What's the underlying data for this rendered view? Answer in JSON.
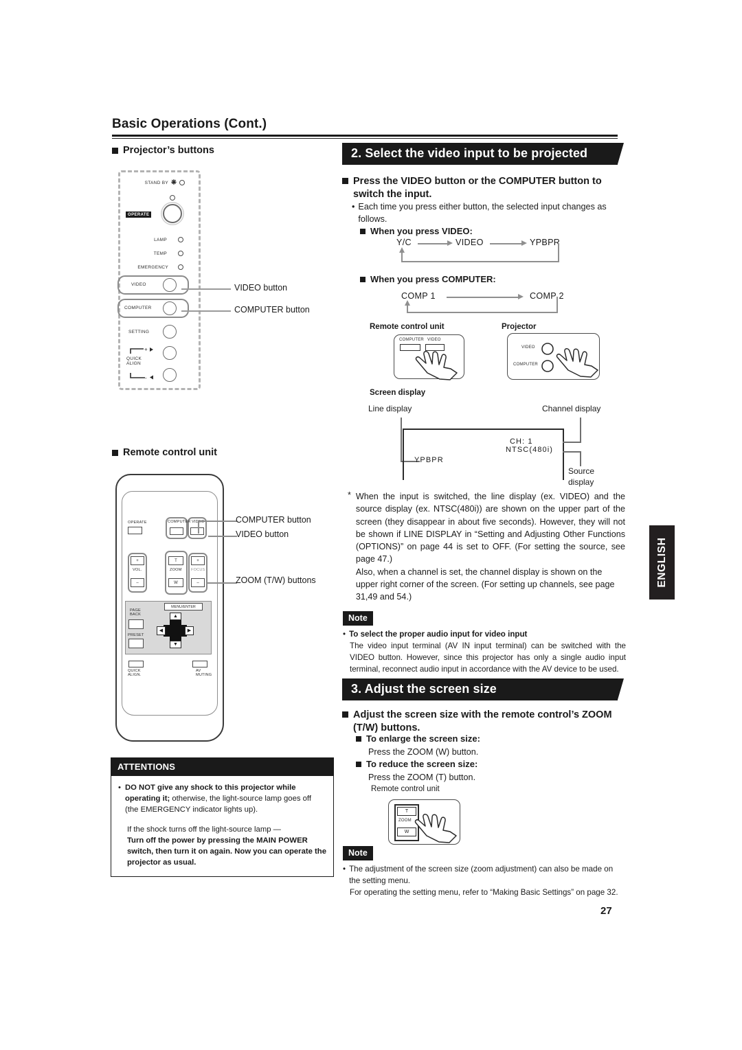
{
  "header": {
    "title": "Basic Operations (Cont.)",
    "page_number": "27",
    "language_tab": "ENGLISH"
  },
  "left": {
    "projector_buttons_heading": "Projector’s buttons",
    "remote_unit_heading": "Remote control unit",
    "projector_panel": {
      "indicators": [
        {
          "label": "STAND BY",
          "glyph": "power-glyph"
        },
        {
          "label": "LAMP"
        },
        {
          "label": "TEMP"
        },
        {
          "label": "EMERGENCY"
        }
      ],
      "operate_tag": "OPERATE",
      "buttons": [
        {
          "label": "VIDEO"
        },
        {
          "label": "COMPUTER"
        },
        {
          "label": "SETTING"
        },
        {
          "label": "QUICK"
        },
        {
          "label": "ALIGN"
        }
      ],
      "plus_mark": "+",
      "minus_mark": "-"
    },
    "callouts": [
      {
        "text": "VIDEO button"
      },
      {
        "text": "COMPUTER button"
      }
    ],
    "remote": {
      "operate_label": "OPERATE",
      "computer_label": "COMPUTER",
      "video_label": "VIDEO",
      "vol_label": "VOL.",
      "zoom_label": "ZOOM",
      "focus_label": "FOCUS",
      "t_label": "T",
      "w_label": "W",
      "plus_label": "+",
      "minus_label": "–",
      "page_back_label": "PAGE\nBACK",
      "preset_label": "PRESET",
      "menu_enter_label": "MENU/ENTER",
      "quick_align_label": "QUICK\nALIGN.",
      "av_muting_label": "AV\nMUTING",
      "arrow_up": "▲",
      "arrow_down": "▼",
      "arrow_left": "◀",
      "arrow_right": "▶",
      "callouts": [
        "COMPUTER button",
        "VIDEO button",
        "ZOOM (T/W) buttons"
      ]
    },
    "attentions": {
      "title": "ATTENTIONS",
      "bullet": "•",
      "p1_bold": "DO NOT give any shock to this projector while operating it;",
      "p1_rest": " otherwise, the light-source lamp goes off (the EMERGENCY indicator lights up).",
      "p2_normal": "If the shock turns off the light-source lamp —",
      "p2_bold": "Turn off the power by pressing the MAIN POWER switch, then turn it on again. Now you can operate the projector as usual."
    }
  },
  "right": {
    "section2": {
      "banner": "2. Select the video input to be projected",
      "heading": "Press the VIDEO button or the COMPUTER button to switch the input.",
      "bullet": "•",
      "body": "Each time you press either button, the selected input changes as follows.",
      "video_cycle_heading": "When you press VIDEO:",
      "video_cycle": [
        "Y/C",
        "VIDEO",
        "YPBPR"
      ],
      "computer_cycle_heading": "When you press COMPUTER:",
      "computer_cycle": [
        "COMP  1",
        "COMP  2"
      ],
      "fig_remote_caption": "Remote control unit",
      "fig_projector_caption": "Projector",
      "fig_remote_buttons": [
        "COMPUTER",
        "VIDEO"
      ],
      "fig_projector_buttons": [
        "VIDEO",
        "COMPUTER"
      ],
      "screen_display_caption": "Screen display",
      "screen_display": {
        "line_display_label": "Line display",
        "channel_display_label": "Channel display",
        "source_display_label": "Source\ndisplay",
        "line_value": "YPBPR",
        "channel_value": "CH:       1",
        "source_value": "NTSC(480i)"
      },
      "asterisk": "*",
      "note_paragraph": "When the input is switched, the line display (ex. VIDEO) and the source display (ex. NTSC(480i)) are shown on the upper part of the screen (they disappear in about five seconds). However, they will not be shown if LINE DISPLAY in “Setting and Adjusting Other Functions (OPTIONS)” on page 44 is set to OFF. (For setting the source, see page 47.)",
      "note_paragraph2": "Also, when a channel is set, the channel display is shown on the upper right corner of the screen. (For setting up channels, see page 31,49 and 54.)",
      "note": {
        "tag": "Note",
        "bullet": "•",
        "title": "To select the proper audio input for video input",
        "text": "The video input terminal (AV IN input terminal) can be switched with the VIDEO button. However, since this projector has only a single audio input terminal, reconnect audio input in accordance with the AV device to be used."
      }
    },
    "section3": {
      "banner": "3. Adjust the screen size",
      "heading": "Adjust the screen size with the remote control’s ZOOM (T/W) buttons.",
      "enlarge_heading": "To enlarge the screen size:",
      "enlarge_text": "Press the ZOOM (W) button.",
      "reduce_heading": "To reduce the screen size:",
      "reduce_text": "Press the ZOOM (T) button.",
      "fig_caption": "Remote control unit",
      "fig_buttons": {
        "t": "T",
        "zoom": "ZOOM",
        "w": "W"
      },
      "note": {
        "tag": "Note",
        "bullet": "•",
        "text": "The adjustment of the screen size (zoom adjustment) can also be made on the setting menu.",
        "text2": "For operating the setting menu, refer to “Making Basic Settings” on page 32."
      }
    }
  },
  "colors": {
    "ink": "#1a1a1a",
    "gray_rule": "#8f8f8f",
    "dashed_panel": "#b3b3b3",
    "pad_fill": "#d9d9d9",
    "tab_bg": "#231f20"
  }
}
